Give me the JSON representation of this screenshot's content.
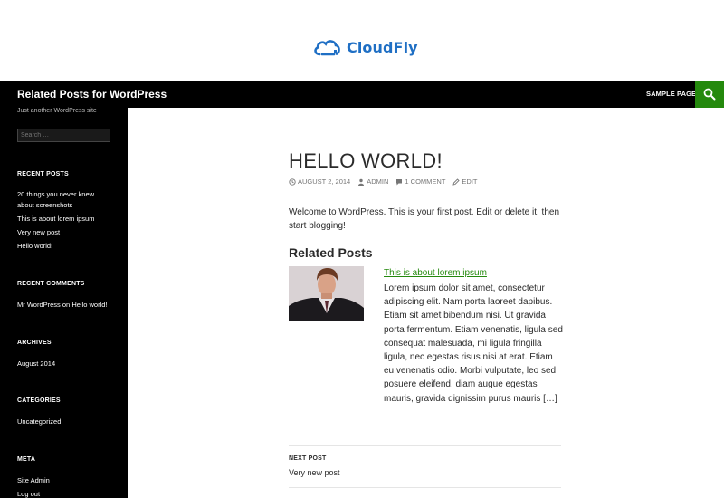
{
  "brand": {
    "name": "CloudFly",
    "logo_icon": "cloud-icon",
    "color": "#1f6fc4"
  },
  "header": {
    "site_title": "Related Posts for WordPress",
    "nav": [
      {
        "label": "SAMPLE PAGE"
      }
    ],
    "search_icon": "search-icon",
    "accent": "#24890d"
  },
  "sidebar": {
    "tagline": "Just another WordPress site",
    "search_placeholder": "Search …",
    "recent_posts": {
      "title": "RECENT POSTS",
      "items": [
        "20 things you never knew about screenshots",
        "This is about lorem ipsum",
        "Very new post",
        "Hello world!"
      ]
    },
    "recent_comments": {
      "title": "RECENT COMMENTS",
      "author": "Mr WordPress",
      "on": "on",
      "post": "Hello world!"
    },
    "archives": {
      "title": "ARCHIVES",
      "items": [
        "August 2014"
      ]
    },
    "categories": {
      "title": "CATEGORIES",
      "items": [
        "Uncategorized"
      ]
    },
    "meta": {
      "title": "META",
      "items": [
        "Site Admin",
        "Log out"
      ]
    }
  },
  "post": {
    "title": "HELLO WORLD!",
    "date": "AUGUST 2, 2014",
    "author": "ADMIN",
    "comments": "1 COMMENT",
    "edit": "EDIT",
    "body": "Welcome to WordPress. This is your first post. Edit or delete it, then start blogging!",
    "related_heading": "Related Posts",
    "related": [
      {
        "title": "This is about lorem ipsum",
        "excerpt": "Lorem ipsum dolor sit amet, consectetur adipiscing elit. Nam porta laoreet dapibus. Etiam sit amet bibendum nisi. Ut gravida porta fermentum. Etiam venenatis, ligula sed consequat malesuada, mi ligula fringilla ligula, nec egestas risus nisi at erat. Etiam eu venenatis odio. Morbi vulputate, leo sed posuere eleifend, diam augue egestas mauris, gravida dignissim purus mauris […]"
      }
    ],
    "next_label": "NEXT POST",
    "next_title": "Very new post"
  }
}
